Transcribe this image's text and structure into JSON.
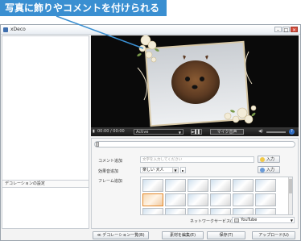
{
  "callout": {
    "text": "写真に飾りやコメントを付けられる"
  },
  "window": {
    "title": "xDeco",
    "controls": {
      "minimize": "–",
      "maximize": "□",
      "close": "×"
    }
  },
  "left_pane": {
    "section_label": "デコレーションの設定"
  },
  "player": {
    "time": "00:00 / 00:00",
    "dropdown_value": "Active",
    "step_label": "►▌▌",
    "mic_label": "マイク音声",
    "help": "?"
  },
  "panel": {
    "comment_label": "コメント追加",
    "comment_placeholder": "文字を入力してください",
    "enter_label": "入力",
    "effect_label": "効果音追加",
    "effect_value": "楽しい 大人",
    "frame_label": "フレーム追加",
    "network_label": "ネットワークサービス(N)",
    "network_value": "YouTube"
  },
  "bottom": {
    "back": "≪ デコレーション一覧(B)",
    "edit": "素材を編集(E)",
    "save": "保存(T)",
    "upload": "アップロード(U)"
  },
  "colors": {
    "callout": "#3a8fd1",
    "accent": "#2f6dc4"
  }
}
